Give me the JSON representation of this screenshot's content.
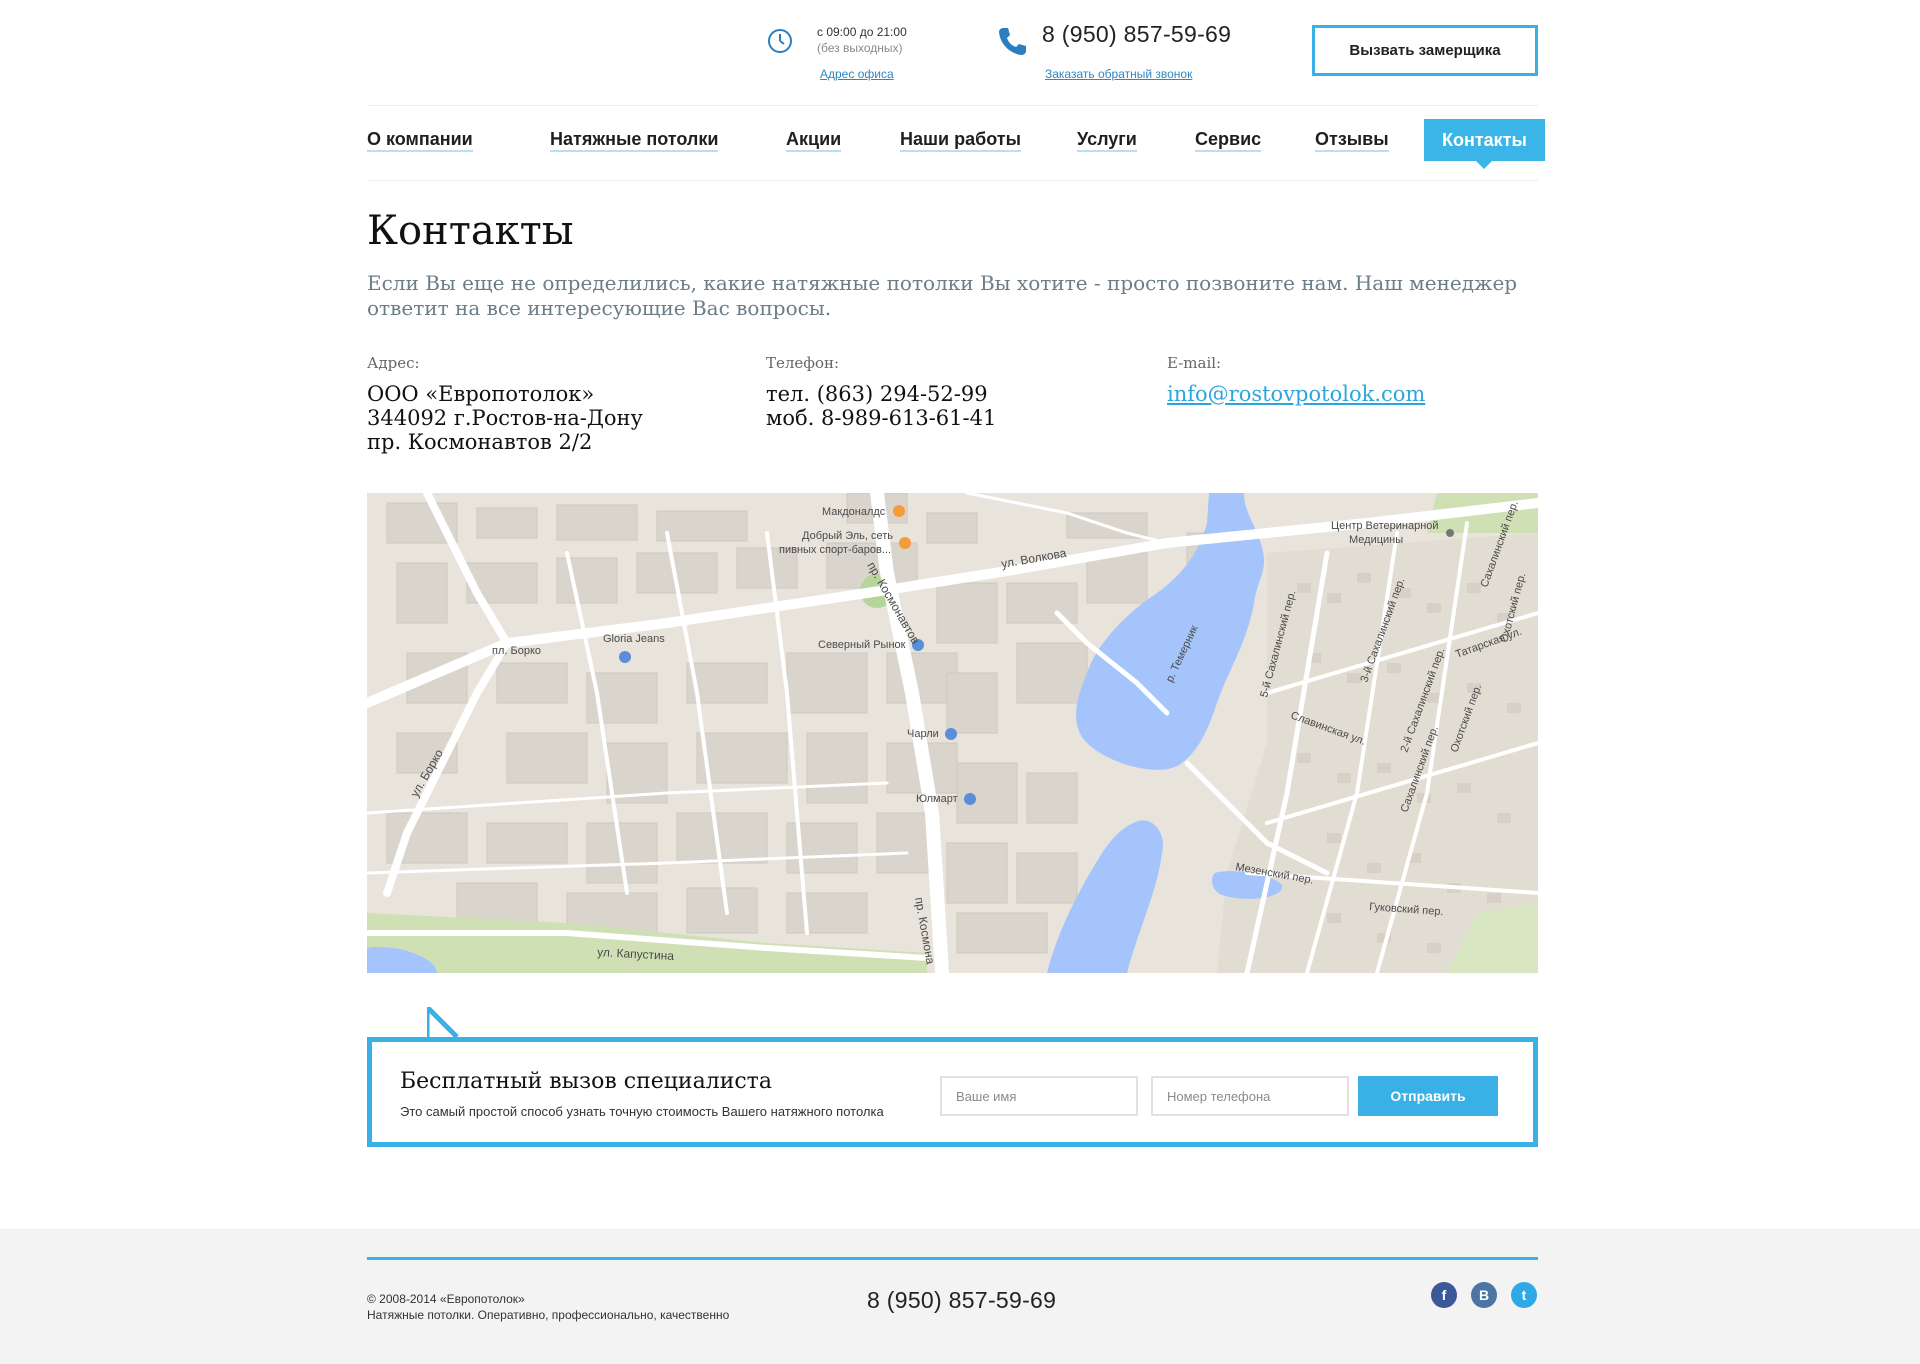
{
  "header": {
    "hours_main": "с 09:00 до 21:00",
    "hours_sub": "(без выходных)",
    "office_link": "Адрес офиса",
    "phone": "8 (950) 857-59-69",
    "callback_link": "Заказать обратный звонок",
    "cta_button": "Вызвать замерщика"
  },
  "nav": {
    "items": [
      {
        "label": "О компании"
      },
      {
        "label": "Натяжные потолки"
      },
      {
        "label": "Акции"
      },
      {
        "label": "Наши работы"
      },
      {
        "label": "Услуги"
      },
      {
        "label": "Сервис"
      },
      {
        "label": "Отзывы"
      },
      {
        "label": "Контакты",
        "active": true
      }
    ]
  },
  "page": {
    "title": "Контакты",
    "intro": "Если Вы еще не определились, какие натяжные потолки Вы хотите - просто позвоните нам. Наш менеджер ответит на все интересующие Вас вопросы."
  },
  "contacts": {
    "address": {
      "label": "Адрес:",
      "lines": [
        "ООО «Европотолок»",
        "344092 г.Ростов-на-Дону",
        "пр. Космонавтов 2/2"
      ]
    },
    "phone": {
      "label": "Телефон:",
      "lines": [
        "тел. (863) 294-52-99",
        "моб. 8-989-613-61-41"
      ]
    },
    "email": {
      "label": "E-mail:",
      "value": "info@rostovpotolok.com"
    }
  },
  "map": {
    "labels": {
      "mcdonalds": "Макдоналдс",
      "bar": "Добрый Эль, сеть",
      "bar2": "пивных спорт-баров...",
      "street_volkova": "ул. Волкова",
      "kosmonavtov_top": "пр. Космонавтов",
      "kosmonavtov_bottom": "пр. Космона",
      "vet": "Центр Ветеринарной",
      "vet2": "Медицины",
      "borko_square": "пл. Борко",
      "gloria": "Gloria Jeans",
      "market": "Северный Рынок",
      "charli": "Чарли",
      "yulmart": "Юлмарт",
      "street_borko": "ул. Борко",
      "river": "р. Темерник",
      "slavinskaya": "Славинская ул.",
      "sakh5": "5-й Сахалинский пер.",
      "sakh3": "3-й Сахалинский пер.",
      "sakh2": "2-й Сахалинский пер.",
      "sakh": "Сахалинский пер.",
      "sakh_top": "Сахалинский пер.",
      "tatar": "Татарская ул.",
      "okhot": "Охотский пер.",
      "okhot_top": "Охотский пер.",
      "mezen": "Мезенский пер.",
      "gukov": "Гуковский пер.",
      "kapustina": "ул. Капустина"
    }
  },
  "form": {
    "title": "Бесплатный вызов специалиста",
    "subtitle": "Это самый простой способ узнать точную стоимость Вашего натяжного потолка",
    "name_placeholder": "Ваше имя",
    "phone_placeholder": "Номер телефона",
    "submit": "Отправить"
  },
  "footer": {
    "copyright": "© 2008-2014 «Европотолок»",
    "tagline": "Натяжные потолки. Оперативно, профессионально, качественно",
    "phone": "8 (950) 857-59-69",
    "social": [
      {
        "name": "facebook-icon",
        "glyph": "f",
        "color": "#3b5998"
      },
      {
        "name": "vk-icon",
        "glyph": "В",
        "color": "#4c75a3"
      },
      {
        "name": "twitter-icon",
        "glyph": "t",
        "color": "#2ea8e6"
      }
    ]
  },
  "colors": {
    "accent": "#39b1e6",
    "link": "#2b88c5",
    "water": "#a4c4fb",
    "park": "#cfe0b4"
  }
}
